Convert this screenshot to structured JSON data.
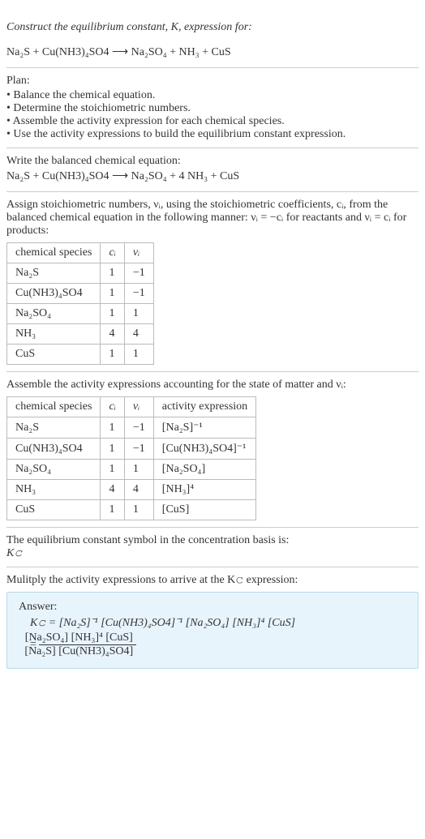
{
  "intro": {
    "line1": "Construct the equilibrium constant, K, expression for:",
    "equation": "Na₂S + Cu(NH3)₄SO4  ⟶  Na₂SO₄ + NH₃ + CuS"
  },
  "plan": {
    "title": "Plan:",
    "items": [
      "Balance the chemical equation.",
      "Determine the stoichiometric numbers.",
      "Assemble the activity expression for each chemical species.",
      "Use the activity expressions to build the equilibrium constant expression."
    ]
  },
  "balanced": {
    "title": "Write the balanced chemical equation:",
    "equation": "Na₂S + Cu(NH3)₄SO4  ⟶  Na₂SO₄ + 4 NH₃ + CuS"
  },
  "stoich_intro": "Assign stoichiometric numbers, νᵢ, using the stoichiometric coefficients, cᵢ, from the balanced chemical equation in the following manner: νᵢ = −cᵢ for reactants and νᵢ = cᵢ for products:",
  "table1": {
    "headers": [
      "chemical species",
      "cᵢ",
      "νᵢ"
    ],
    "rows": [
      [
        "Na₂S",
        "1",
        "−1"
      ],
      [
        "Cu(NH3)₄SO4",
        "1",
        "−1"
      ],
      [
        "Na₂SO₄",
        "1",
        "1"
      ],
      [
        "NH₃",
        "4",
        "4"
      ],
      [
        "CuS",
        "1",
        "1"
      ]
    ]
  },
  "activity_intro": "Assemble the activity expressions accounting for the state of matter and νᵢ:",
  "table2": {
    "headers": [
      "chemical species",
      "cᵢ",
      "νᵢ",
      "activity expression"
    ],
    "rows": [
      [
        "Na₂S",
        "1",
        "−1",
        "[Na₂S]⁻¹"
      ],
      [
        "Cu(NH3)₄SO4",
        "1",
        "−1",
        "[Cu(NH3)₄SO4]⁻¹"
      ],
      [
        "Na₂SO₄",
        "1",
        "1",
        "[Na₂SO₄]"
      ],
      [
        "NH₃",
        "4",
        "4",
        "[NH₃]⁴"
      ],
      [
        "CuS",
        "1",
        "1",
        "[CuS]"
      ]
    ]
  },
  "symbol_intro": "The equilibrium constant symbol in the concentration basis is:",
  "symbol": "K𝚌",
  "multiply_intro": "Mulitply the activity expressions to arrive at the K𝚌 expression:",
  "answer": {
    "label": "Answer:",
    "line1": "K𝚌 = [Na₂S]⁻¹ [Cu(NH3)₄SO4]⁻¹ [Na₂SO₄] [NH₃]⁴ [CuS]",
    "frac_prefix": "= ",
    "frac_num": "[Na₂SO₄] [NH₃]⁴ [CuS]",
    "frac_den": "[Na₂S] [Cu(NH3)₄SO4]"
  }
}
